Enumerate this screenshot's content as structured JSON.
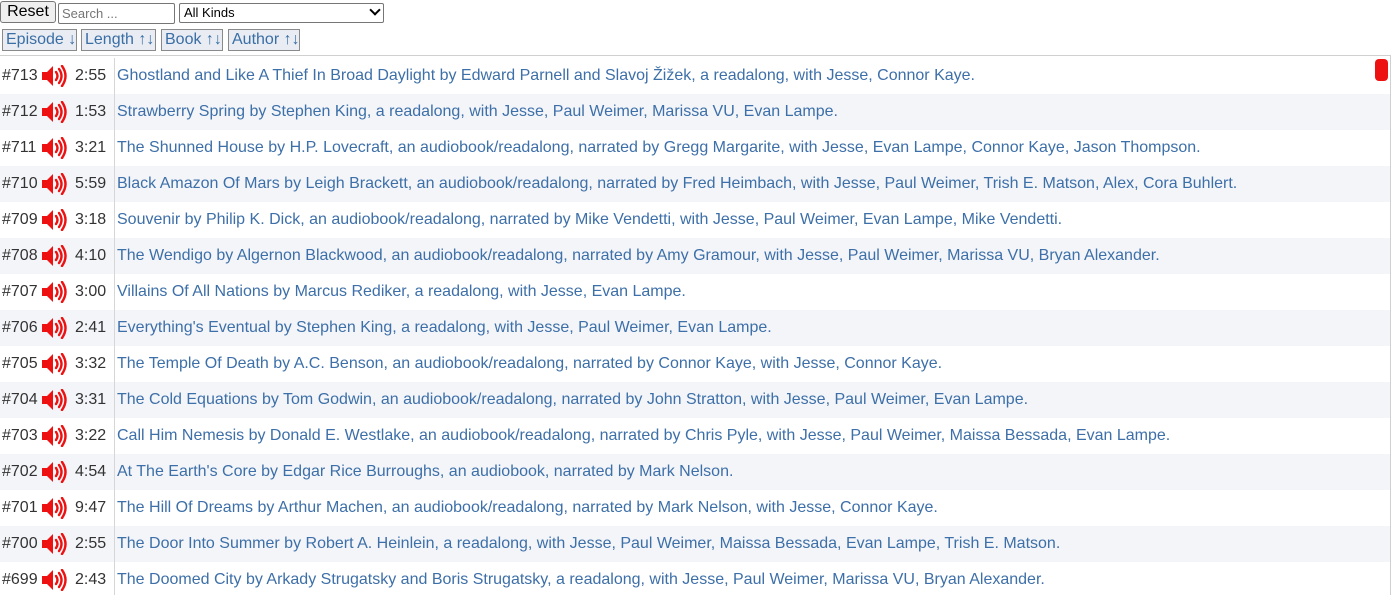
{
  "toolbar": {
    "reset_label": "Reset",
    "search_placeholder": "Search ...",
    "search_value": "",
    "kinds_selected": "All Kinds"
  },
  "sort_buttons": [
    {
      "label": "Episode ↓"
    },
    {
      "label": "Length ↑↓"
    },
    {
      "label": "Book ↑↓"
    },
    {
      "label": "Author ↑↓"
    }
  ],
  "colors": {
    "link": "#3d6fa8",
    "speaker": "#ee1111",
    "alt_row": "#f3f5f9"
  },
  "episodes": [
    {
      "episode": "#713",
      "length": "2:55",
      "title": "Ghostland and Like A Thief In Broad Daylight by Edward Parnell and Slavoj Žižek, a readalong, with Jesse, Connor Kaye."
    },
    {
      "episode": "#712",
      "length": "1:53",
      "title": "Strawberry Spring by Stephen King, a readalong, with Jesse, Paul Weimer, Marissa VU, Evan Lampe."
    },
    {
      "episode": "#711",
      "length": "3:21",
      "title": "The Shunned House by H.P. Lovecraft, an audiobook/readalong, narrated by Gregg Margarite, with Jesse, Evan Lampe, Connor Kaye, Jason Thompson."
    },
    {
      "episode": "#710",
      "length": "5:59",
      "title": "Black Amazon Of Mars by Leigh Brackett, an audiobook/readalong, narrated by Fred Heimbach, with Jesse, Paul Weimer, Trish E. Matson, Alex, Cora Buhlert."
    },
    {
      "episode": "#709",
      "length": "3:18",
      "title": "Souvenir by Philip K. Dick, an audiobook/readalong, narrated by Mike Vendetti, with Jesse, Paul Weimer, Evan Lampe, Mike Vendetti."
    },
    {
      "episode": "#708",
      "length": "4:10",
      "title": "The Wendigo by Algernon Blackwood, an audiobook/readalong, narrated by Amy Gramour, with Jesse, Paul Weimer, Marissa VU, Bryan Alexander."
    },
    {
      "episode": "#707",
      "length": "3:00",
      "title": "Villains Of All Nations by Marcus Rediker, a readalong, with Jesse, Evan Lampe."
    },
    {
      "episode": "#706",
      "length": "2:41",
      "title": "Everything's Eventual by Stephen King, a readalong, with Jesse, Paul Weimer, Evan Lampe."
    },
    {
      "episode": "#705",
      "length": "3:32",
      "title": "The Temple Of Death by A.C. Benson, an audiobook/readalong, narrated by Connor Kaye, with Jesse, Connor Kaye."
    },
    {
      "episode": "#704",
      "length": "3:31",
      "title": "The Cold Equations by Tom Godwin, an audiobook/readalong, narrated by John Stratton, with Jesse, Paul Weimer, Evan Lampe."
    },
    {
      "episode": "#703",
      "length": "3:22",
      "title": "Call Him Nemesis by Donald E. Westlake, an audiobook/readalong, narrated by Chris Pyle, with Jesse, Paul Weimer, Maissa Bessada, Evan Lampe."
    },
    {
      "episode": "#702",
      "length": "4:54",
      "title": "At The Earth's Core by Edgar Rice Burroughs, an audiobook, narrated by Mark Nelson."
    },
    {
      "episode": "#701",
      "length": "9:47",
      "title": "The Hill Of Dreams by Arthur Machen, an audiobook/readalong, narrated by Mark Nelson, with Jesse, Connor Kaye."
    },
    {
      "episode": "#700",
      "length": "2:55",
      "title": "The Door Into Summer by Robert A. Heinlein, a readalong, with Jesse, Paul Weimer, Maissa Bessada, Evan Lampe, Trish E. Matson."
    },
    {
      "episode": "#699",
      "length": "2:43",
      "title": "The Doomed City by Arkady Strugatsky and Boris Strugatsky, a readalong, with Jesse, Paul Weimer, Marissa VU, Bryan Alexander."
    }
  ]
}
